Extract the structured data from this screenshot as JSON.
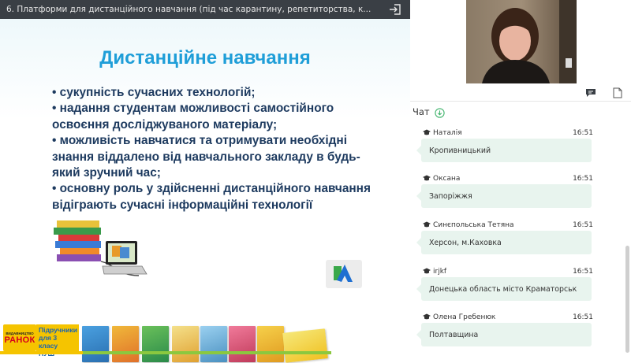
{
  "window": {
    "title": "6. Платформи для дистанційного навчання (під час карантину, репетиторства, к...",
    "exit_icon": "exit-fullscreen-icon"
  },
  "slide": {
    "title": "Дистанційне навчання",
    "bullets": [
      "•  сукупність сучасних технологій;",
      "• надання студентам можливості самостійного освоєння досліджуваного матеріалу;",
      "• можливість навчатися та отримувати необхідні знання віддалено від навчального закладу в будь-який зручний час;",
      "• основну роль у здійсненні дистанційного навчання відіграють сучасні інформаційні технології"
    ],
    "banner": {
      "publisher_small": "ВИДАВНИЦТВО",
      "publisher": "РАНОК",
      "tagline_line1": "Підручники",
      "tagline_line2": "для 3 класу",
      "tagline_line3": "НУШ"
    },
    "colors": {
      "title": "#1f9ed8",
      "bullets": "#1d3a5f"
    }
  },
  "chat": {
    "header": "Чат",
    "messages": [
      {
        "author": "Наталія",
        "time": "16:51",
        "text": "Кропивницький"
      },
      {
        "author": "Оксана",
        "time": "16:51",
        "text": "Запоріжжя"
      },
      {
        "author": "Синєпольська Тетяна",
        "time": "16:51",
        "text": "Херсон, м.Каховка"
      },
      {
        "author": "irjkf",
        "time": "16:51",
        "text": "Донецька область місто Краматорськ"
      },
      {
        "author": "Олена Гребенюк",
        "time": "16:51",
        "text": "Полтавщина"
      }
    ],
    "colors": {
      "bubble": "#e8f4ee",
      "accent": "#3fb36b"
    }
  },
  "icons": {
    "chat_toggle": "chat-bubble-icon",
    "notes": "document-icon",
    "download": "download-icon",
    "author_badge": "graduation-cap-icon"
  }
}
